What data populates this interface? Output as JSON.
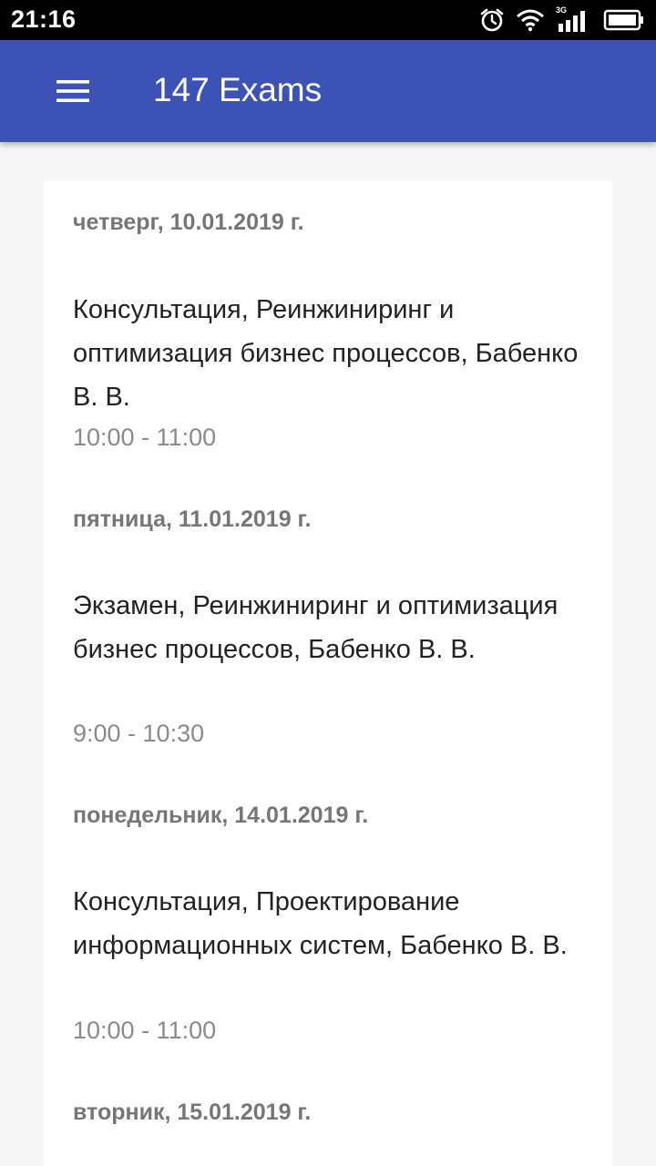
{
  "status_bar": {
    "time": "21:16",
    "network_label": "3G",
    "icons": [
      "alarm-icon",
      "wifi-icon",
      "signal-icon",
      "battery-icon"
    ]
  },
  "app_bar": {
    "title": "147 Exams",
    "menu_icon": "hamburger-menu-icon",
    "color": "#3d52b5"
  },
  "exams": [
    {
      "date": "четверг, 10.01.2019 г.",
      "title": "Консультация, Реинжиниринг и оптимизация бизнес процессов, Бабенко В. В.",
      "time": "10:00 - 11:00"
    },
    {
      "date": "пятница, 11.01.2019 г.",
      "title": "Экзамен, Реинжиниринг и оптимизация бизнес процессов, Бабенко В. В.",
      "time": "9:00 - 10:30"
    },
    {
      "date": "понедельник, 14.01.2019 г.",
      "title": "Консультация, Проектирование информационных систем, Бабенко В. В.",
      "time": "10:00 - 11:00"
    },
    {
      "date": "вторник, 15.01.2019 г.",
      "title": "",
      "time": ""
    }
  ]
}
